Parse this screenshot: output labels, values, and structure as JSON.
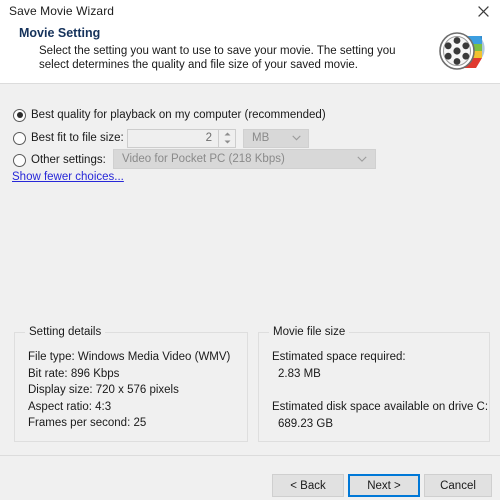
{
  "window": {
    "title": "Save Movie Wizard",
    "close_icon": "close-icon"
  },
  "header": {
    "title": "Movie Setting",
    "description": "Select the setting you want to use to save your movie. The setting you select determines the quality and file size of your saved movie.",
    "icon": "movie-reel-icon"
  },
  "options": {
    "best_quality": {
      "label": "Best quality for playback on my computer (recommended)",
      "selected": true
    },
    "best_fit": {
      "label": "Best fit to file size:",
      "selected": false,
      "size_value": "2",
      "unit_value": "MB",
      "unit_chevron": "chevron-down-icon",
      "spinner_up": "spinner-up-icon",
      "spinner_down": "spinner-down-icon"
    },
    "other_settings": {
      "label": "Other settings:",
      "selected": false,
      "selected_profile": "Video for Pocket PC (218 Kbps)",
      "chevron": "chevron-down-icon"
    },
    "show_fewer_link": "Show fewer choices..."
  },
  "setting_details": {
    "title": "Setting details",
    "file_type": "File type: Windows Media Video (WMV)",
    "bit_rate": "Bit rate: 896 Kbps",
    "display_size": "Display size: 720 x 576 pixels",
    "aspect_ratio": "Aspect ratio: 4:3",
    "frames_per_second": "Frames per second: 25"
  },
  "movie_file_size": {
    "title": "Movie file size",
    "estimated_space_label": "Estimated space required:",
    "estimated_space_value": "2.83 MB",
    "disk_space_label": "Estimated disk space available on drive C:",
    "disk_space_value": "689.23 GB"
  },
  "footer": {
    "back_label": "< Back",
    "next_label": "Next >",
    "cancel_label": "Cancel"
  },
  "colors": {
    "window_bg": "#f0f0f0",
    "header_bg": "#ffffff",
    "heading_blue": "#15325b",
    "link_blue": "#2727d8",
    "focus_blue": "#0078d7"
  }
}
